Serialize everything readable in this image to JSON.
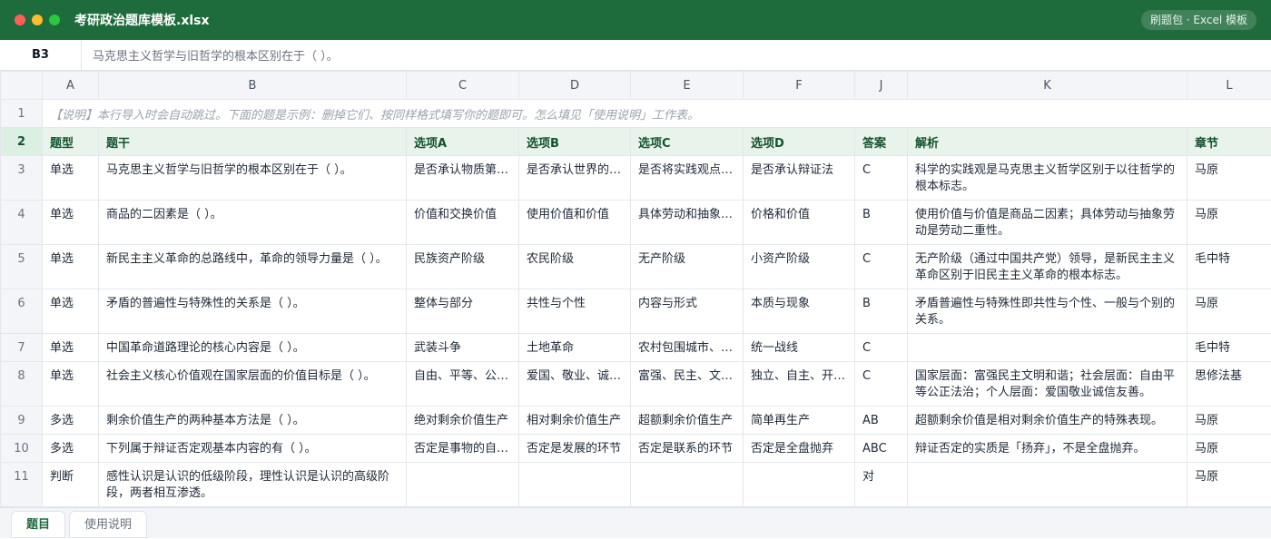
{
  "window": {
    "title": "考研政治题库模板.xlsx",
    "badge": "刷题包 · Excel 模板"
  },
  "formula_bar": {
    "cell_ref": "B3",
    "content": "马克思主义哲学与旧哲学的根本区别在于（ ）。"
  },
  "columns": [
    "A",
    "B",
    "C",
    "D",
    "E",
    "F",
    "J",
    "K",
    "L"
  ],
  "row1": {
    "num": "1",
    "note": "【说明】本行导入时会自动跳过。下面的题是示例：删掉它们、按同样格式填写你的题即可。怎么填见「使用说明」工作表。"
  },
  "headers": {
    "num": "2",
    "cells": [
      "题型",
      "题干",
      "选项A",
      "选项B",
      "选项C",
      "选项D",
      "答案",
      "解析",
      "章节"
    ]
  },
  "rows": [
    {
      "num": "3",
      "cells": [
        "单选",
        "马克思主义哲学与旧哲学的根本区别在于（ ）。",
        "是否承认物质第…",
        "是否承认世界的…",
        "是否将实践观点…",
        "是否承认辩证法",
        "C",
        "科学的实践观是马克思主义哲学区别于以往哲学的根本标志。",
        "马原"
      ]
    },
    {
      "num": "4",
      "cells": [
        "单选",
        "商品的二因素是（ ）。",
        "价值和交换价值",
        "使用价值和价值",
        "具体劳动和抽象…",
        "价格和价值",
        "B",
        "使用价值与价值是商品二因素；具体劳动与抽象劳动是劳动二重性。",
        "马原"
      ]
    },
    {
      "num": "5",
      "cells": [
        "单选",
        "新民主主义革命的总路线中，革命的领导力量是（ ）。",
        "民族资产阶级",
        "农民阶级",
        "无产阶级",
        "小资产阶级",
        "C",
        "无产阶级（通过中国共产党）领导，是新民主主义革命区别于旧民主主义革命的根本标志。",
        "毛中特"
      ]
    },
    {
      "num": "6",
      "cells": [
        "单选",
        "矛盾的普遍性与特殊性的关系是（ ）。",
        "整体与部分",
        "共性与个性",
        "内容与形式",
        "本质与现象",
        "B",
        "矛盾普遍性与特殊性即共性与个性、一般与个别的关系。",
        "马原"
      ]
    },
    {
      "num": "7",
      "cells": [
        "单选",
        "中国革命道路理论的核心内容是（ ）。",
        "武装斗争",
        "土地革命",
        "农村包围城市、…",
        "统一战线",
        "C",
        "",
        "毛中特"
      ]
    },
    {
      "num": "8",
      "cells": [
        "单选",
        "社会主义核心价值观在国家层面的价值目标是（ ）。",
        "自由、平等、公…",
        "爱国、敬业、诚…",
        "富强、民主、文…",
        "独立、自主、开…",
        "C",
        "国家层面：富强民主文明和谐；社会层面：自由平等公正法治；个人层面：爱国敬业诚信友善。",
        "思修法基"
      ]
    },
    {
      "num": "9",
      "cells": [
        "多选",
        "剩余价值生产的两种基本方法是（ ）。",
        "绝对剩余价值生产",
        "相对剩余价值生产",
        "超额剩余价值生产",
        "简单再生产",
        "AB",
        "超额剩余价值是相对剩余价值生产的特殊表现。",
        "马原"
      ]
    },
    {
      "num": "10",
      "cells": [
        "多选",
        "下列属于辩证否定观基本内容的有（ ）。",
        "否定是事物的自…",
        "否定是发展的环节",
        "否定是联系的环节",
        "否定是全盘抛弃",
        "ABC",
        "辩证否定的实质是「扬弃」，不是全盘抛弃。",
        "马原"
      ]
    },
    {
      "num": "11",
      "cells": [
        "判断",
        "感性认识是认识的低级阶段，理性认识是认识的高级阶段，两者相互渗透。",
        "",
        "",
        "",
        "",
        "对",
        "",
        "马原"
      ]
    }
  ],
  "sheet_tabs": [
    {
      "label": "题目",
      "active": true
    },
    {
      "label": "使用说明",
      "active": false
    }
  ],
  "colors": {
    "titlebar": "#1e6b3c",
    "header_row": "#e8f3ec",
    "header_text": "#14532d"
  }
}
